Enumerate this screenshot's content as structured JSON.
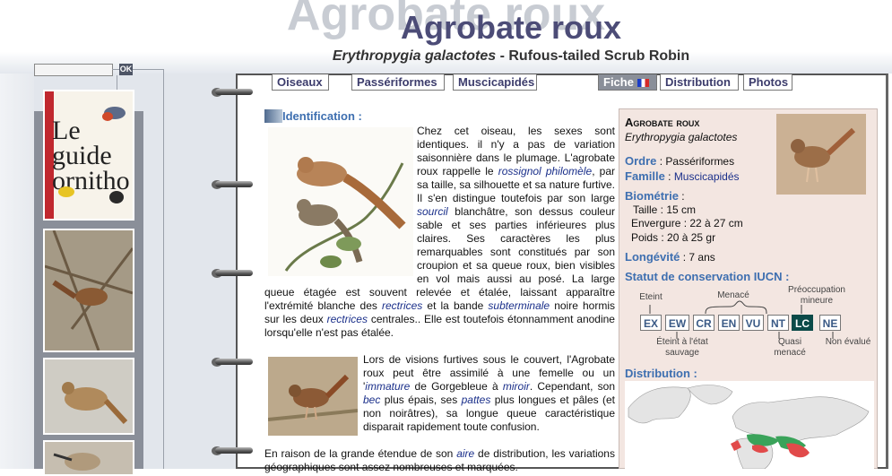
{
  "header": {
    "ghost_title": "Agrobate roux",
    "title": "Agrobate roux",
    "scientific_name": "Erythropygia galactotes",
    "separator": " - ",
    "english_name": "Rufous-tailed Scrub Robin"
  },
  "search": {
    "value": "",
    "ok_label": "OK"
  },
  "book": {
    "title_line1": "Le",
    "title_line2": "guide",
    "title_line3": "ornitho"
  },
  "tabs": [
    {
      "label": "Oiseaux"
    },
    {
      "label": "Passériformes"
    },
    {
      "label": "Muscicapidés"
    },
    {
      "label": "Fiche"
    },
    {
      "label": "Distribution"
    },
    {
      "label": "Photos"
    }
  ],
  "section": {
    "identification": "Identification :"
  },
  "paragraphs": {
    "p1": {
      "t1": "Chez cet oiseau, les sexes sont identiques. il n'y a pas de variation saisonnière dans le plumage. L'agrobate roux rappelle le ",
      "l1": "rossignol philomèle",
      "t2": ", par sa taille, sa silhouette et sa nature furtive. Il s'en distingue toutefois par son large ",
      "l2": "sourcil",
      "t3": " blanchâtre, son dessus couleur sable et ses parties inférieures plus claires. Ses caractères les plus remarquables sont constitués par son croupion et sa queue roux, bien visibles en vol mais aussi au posé. La large queue étagée est souvent relevée et étalée, laissant apparaître l'extrémité blanche des ",
      "l3": "rectrices",
      "t4": " et la bande ",
      "l4": "subterminale",
      "t5": " noire hormis sur les deux ",
      "l5": "rectrices",
      "t6": " centrales.. Elle est toutefois étonnamment anodine lorsqu'elle n'est pas étalée."
    },
    "p2": {
      "t1": "Lors de visions furtives sous le couvert, l'Agrobate roux peut être assimilé à une femelle ou un '",
      "l1": "immature",
      "t2": " de Gorgebleue à ",
      "l2": "miroir",
      "t3": ". Cependant, son ",
      "l3": "bec",
      "t4": " plus épais, ses ",
      "l4": "pattes",
      "t5": " plus longues et pâles (et non noirâtres), sa longue queue caractéristique disparait rapidement toute confusion."
    },
    "p3": {
      "t1": "En raison de la grande étendue de son ",
      "l1": "aire",
      "t2": " de distribution, les variations géographiques sont assez nombreuses et marquées."
    }
  },
  "infobox": {
    "name": "Agrobate roux",
    "scientific": "Erythropygia galactotes",
    "ordre_label": "Ordre",
    "ordre_value": "Passériformes",
    "famille_label": "Famille",
    "famille_value": "Muscicapidés",
    "biometrie_label": "Biométrie",
    "taille": "Taille : 15 cm",
    "envergure": "Envergure : 22 à 27 cm",
    "poids": "Poids : 20 à 25 gr",
    "longevite_label": "Longévité",
    "longevite_value": "7 ans",
    "statut_label": "Statut de conservation IUCN :",
    "iucn": [
      "EX",
      "EW",
      "CR",
      "EN",
      "VU",
      "NT",
      "LC",
      "NE"
    ],
    "iucn_selected": "LC",
    "iucn_top_labels": {
      "eteint": "Eteint",
      "menace": "Menacé",
      "preoccupation": "Préoccupation mineure"
    },
    "iucn_bottom_labels": {
      "eteint_sauvage": "Éteint à l'état sauvage",
      "quasi": "Quasi menacé",
      "non_evalue": "Non évalué"
    },
    "distribution_label": "Distribution :"
  },
  "colors": {
    "title": "#4c4c77",
    "accent_blue": "#3e6fb0",
    "link": "#1a2f8a",
    "infobox_bg": "#f3e6e1",
    "iucn_selected": "#0b4a48"
  }
}
